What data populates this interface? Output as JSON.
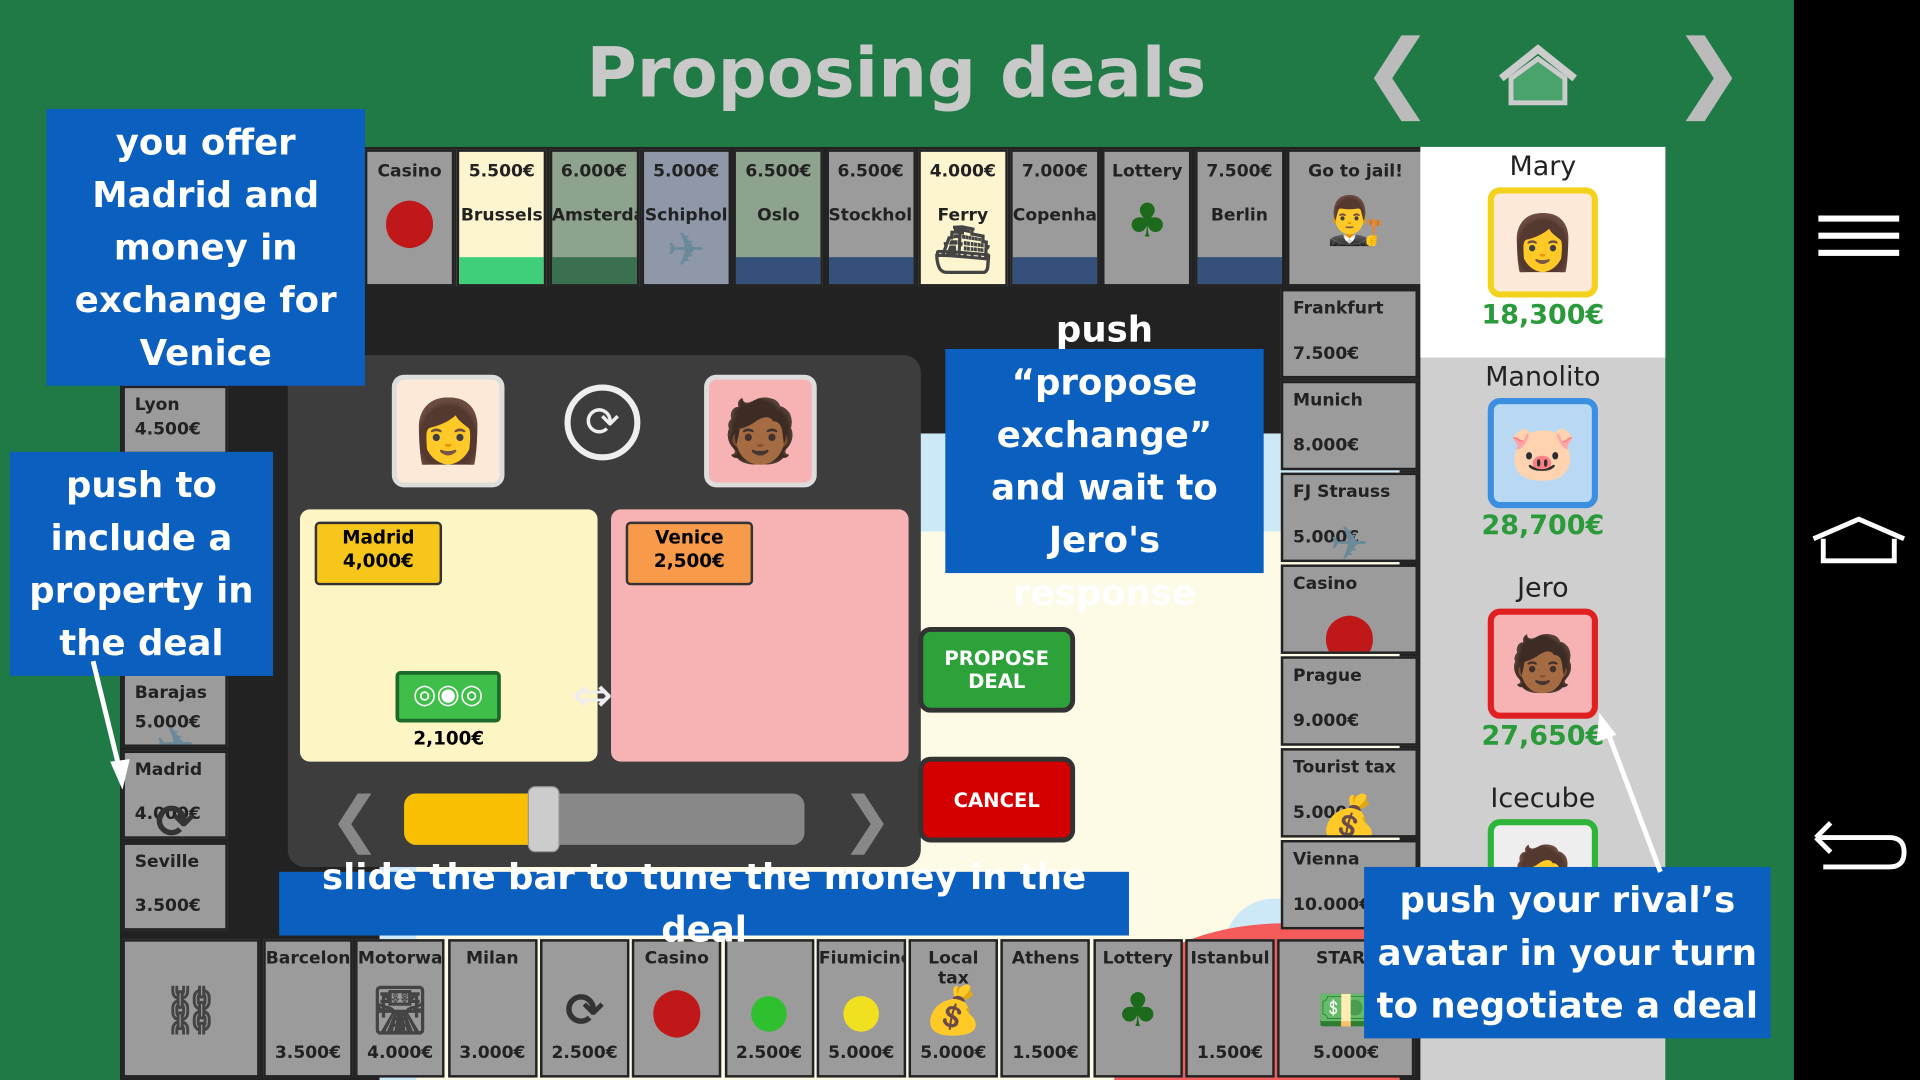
{
  "title": "Proposing deals",
  "nav": {
    "prev_icon": "chevron-left-icon",
    "home_icon": "home-icon",
    "next_icon": "chevron-right-icon"
  },
  "system_bar": {
    "menu_icon": "hamburger-menu-icon",
    "home_icon": "android-home-icon",
    "back_icon": "android-back-icon"
  },
  "board": {
    "top": [
      {
        "name": "Casino",
        "price": "",
        "icon": "casino-chip-icon",
        "color": ""
      },
      {
        "name": "Brussels",
        "price": "5.500€",
        "color": "#3fcf7a",
        "bg": "#fdf5cf"
      },
      {
        "name": "Amsterdam",
        "price": "6.000€",
        "color": "#3a7050",
        "bg": "#8ea38e"
      },
      {
        "name": "Schiphol",
        "price": "5.000€",
        "icon": "airplane-icon",
        "color": "",
        "bg": "#8f98a8"
      },
      {
        "name": "Oslo",
        "price": "6.500€",
        "color": "#35507a",
        "bg": "#8ea38e"
      },
      {
        "name": "Stockholm",
        "price": "6.500€",
        "color": "#35507a",
        "bg": "#9b9b9b"
      },
      {
        "name": "Ferry",
        "price": "4.000€",
        "icon": "ferry-icon",
        "color": "",
        "bg": "#fdf5cf"
      },
      {
        "name": "Copenhagen",
        "price": "7.000€",
        "color": "#35507a",
        "bg": "#9b9b9b"
      },
      {
        "name": "Lottery",
        "price": "",
        "icon": "clover-icon",
        "color": ""
      },
      {
        "name": "Berlin",
        "price": "7.500€",
        "color": "#35507a",
        "bg": "#9b9b9b"
      },
      {
        "name": "Go to jail!",
        "price": "",
        "icon": "judge-icon",
        "color": ""
      }
    ],
    "right": [
      {
        "name": "Frankfurt",
        "price": "7.500€"
      },
      {
        "name": "Munich",
        "price": "8.000€"
      },
      {
        "name": "FJ Strauss",
        "price": "5.000€",
        "icon": "airplane-icon"
      },
      {
        "name": "Casino",
        "price": "",
        "icon": "casino-chip-icon"
      },
      {
        "name": "Prague",
        "price": "9.000€"
      },
      {
        "name": "Tourist tax",
        "price": "5.000€",
        "icon": "money-bag-icon"
      },
      {
        "name": "Vienna",
        "price": "10.000€"
      }
    ],
    "left": [
      {
        "name": "Lyon",
        "price": "4.500€"
      },
      {
        "name": "Barajas",
        "price": "5.000€",
        "icon": "airplane-icon"
      },
      {
        "name": "Madrid",
        "price": "4.000€",
        "icon": "deal-icon"
      },
      {
        "name": "Seville",
        "price": "3.500€"
      }
    ],
    "bottom": [
      {
        "name": "",
        "price": "",
        "icon": "jail-icon"
      },
      {
        "name": "Barcelona",
        "price": "3.500€"
      },
      {
        "name": "Motorway",
        "price": "4.000€",
        "icon": "motorway-icon"
      },
      {
        "name": "Milan",
        "price": "3.000€"
      },
      {
        "name": "",
        "price": "2.500€",
        "icon": "deal-icon"
      },
      {
        "name": "Casino",
        "price": "",
        "icon": "casino-chip-icon"
      },
      {
        "name": "",
        "price": "2.500€",
        "icon": "green-ball-icon"
      },
      {
        "name": "Fiumicino",
        "price": "5.000€",
        "icon": "yellow-ball-icon"
      },
      {
        "name": "Local tax",
        "price": "5.000€",
        "icon": "money-bag-icon"
      },
      {
        "name": "Athens",
        "price": "1.500€"
      },
      {
        "name": "Lottery",
        "price": "",
        "icon": "clover-icon"
      },
      {
        "name": "Istanbul",
        "price": "1.500€"
      },
      {
        "name": "START",
        "price": "5.000€",
        "icon": "banknote-icon"
      }
    ]
  },
  "players": [
    {
      "name": "Mary",
      "money": "18,300€",
      "border": "#f2d21b",
      "active": true
    },
    {
      "name": "Manolito",
      "money": "28,700€",
      "border": "#3a8fe0"
    },
    {
      "name": "Jero",
      "money": "27,650€",
      "border": "#e02020"
    },
    {
      "name": "Icecube",
      "money": "",
      "border": "#2fb43a"
    }
  ],
  "deal": {
    "swap_icon": "swap-icon",
    "offer": {
      "property": "Madrid",
      "price": "4,000€",
      "money": "2,100€"
    },
    "request": {
      "property": "Venice",
      "price": "2,500€"
    },
    "slider_fraction": 0.35,
    "propose_label": "PROPOSE DEAL",
    "cancel_label": "CANCEL"
  },
  "callouts": {
    "offer": "you offer Madrid and money in exchange for Venice",
    "include": "push to include a property in the deal",
    "propose": "push “propose exchange” and wait to Jero's response",
    "slider": "slide the bar to tune the money in the deal",
    "avatar": "push your rival’s avatar in your turn to negotiate a deal"
  },
  "colors": {
    "background": "#1f7a45",
    "callout": "#0a5fbf",
    "offer_panel": "#fdf5c4",
    "request_panel": "#f7b3b3"
  }
}
